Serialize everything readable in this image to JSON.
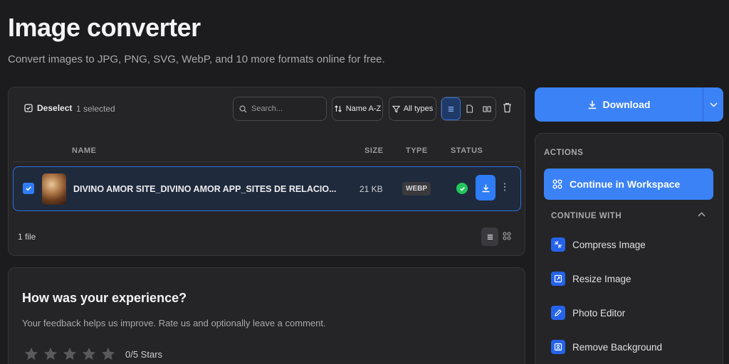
{
  "header": {
    "title": "Image converter",
    "subtitle": "Convert images to JPG, PNG, SVG, WebP, and 10 more formats online for free."
  },
  "toolbar": {
    "deselect_label": "Deselect",
    "selected_count": "1 selected",
    "search_placeholder": "Search...",
    "sort_label": "Name A-Z",
    "filter_label": "All types"
  },
  "table": {
    "columns": {
      "name": "NAME",
      "size": "SIZE",
      "type": "TYPE",
      "status": "STATUS"
    },
    "rows": [
      {
        "name": "DIVINO AMOR SITE_DIVINO AMOR APP_SITES DE RELACIO...",
        "size": "21 KB",
        "type": "WEBP",
        "selected": true,
        "status": "done"
      }
    ],
    "file_count": "1 file"
  },
  "feedback": {
    "title": "How was your experience?",
    "subtitle": "Your feedback helps us improve. Rate us and optionally leave a comment.",
    "stars_label": "0/5 Stars",
    "rating": 0
  },
  "sidebar": {
    "download_label": "Download",
    "actions_label": "ACTIONS",
    "workspace_label": "Continue in Workspace",
    "continue_with_label": "CONTINUE WITH",
    "continue_items": [
      {
        "label": "Compress Image",
        "icon": "compress-icon"
      },
      {
        "label": "Resize Image",
        "icon": "resize-icon"
      },
      {
        "label": "Photo Editor",
        "icon": "pen-icon"
      },
      {
        "label": "Remove Background",
        "icon": "remove-background-icon"
      }
    ]
  },
  "colors": {
    "accent": "#3b82f6",
    "success": "#22c55e",
    "background": "#1c1c1e",
    "card": "#252527"
  }
}
